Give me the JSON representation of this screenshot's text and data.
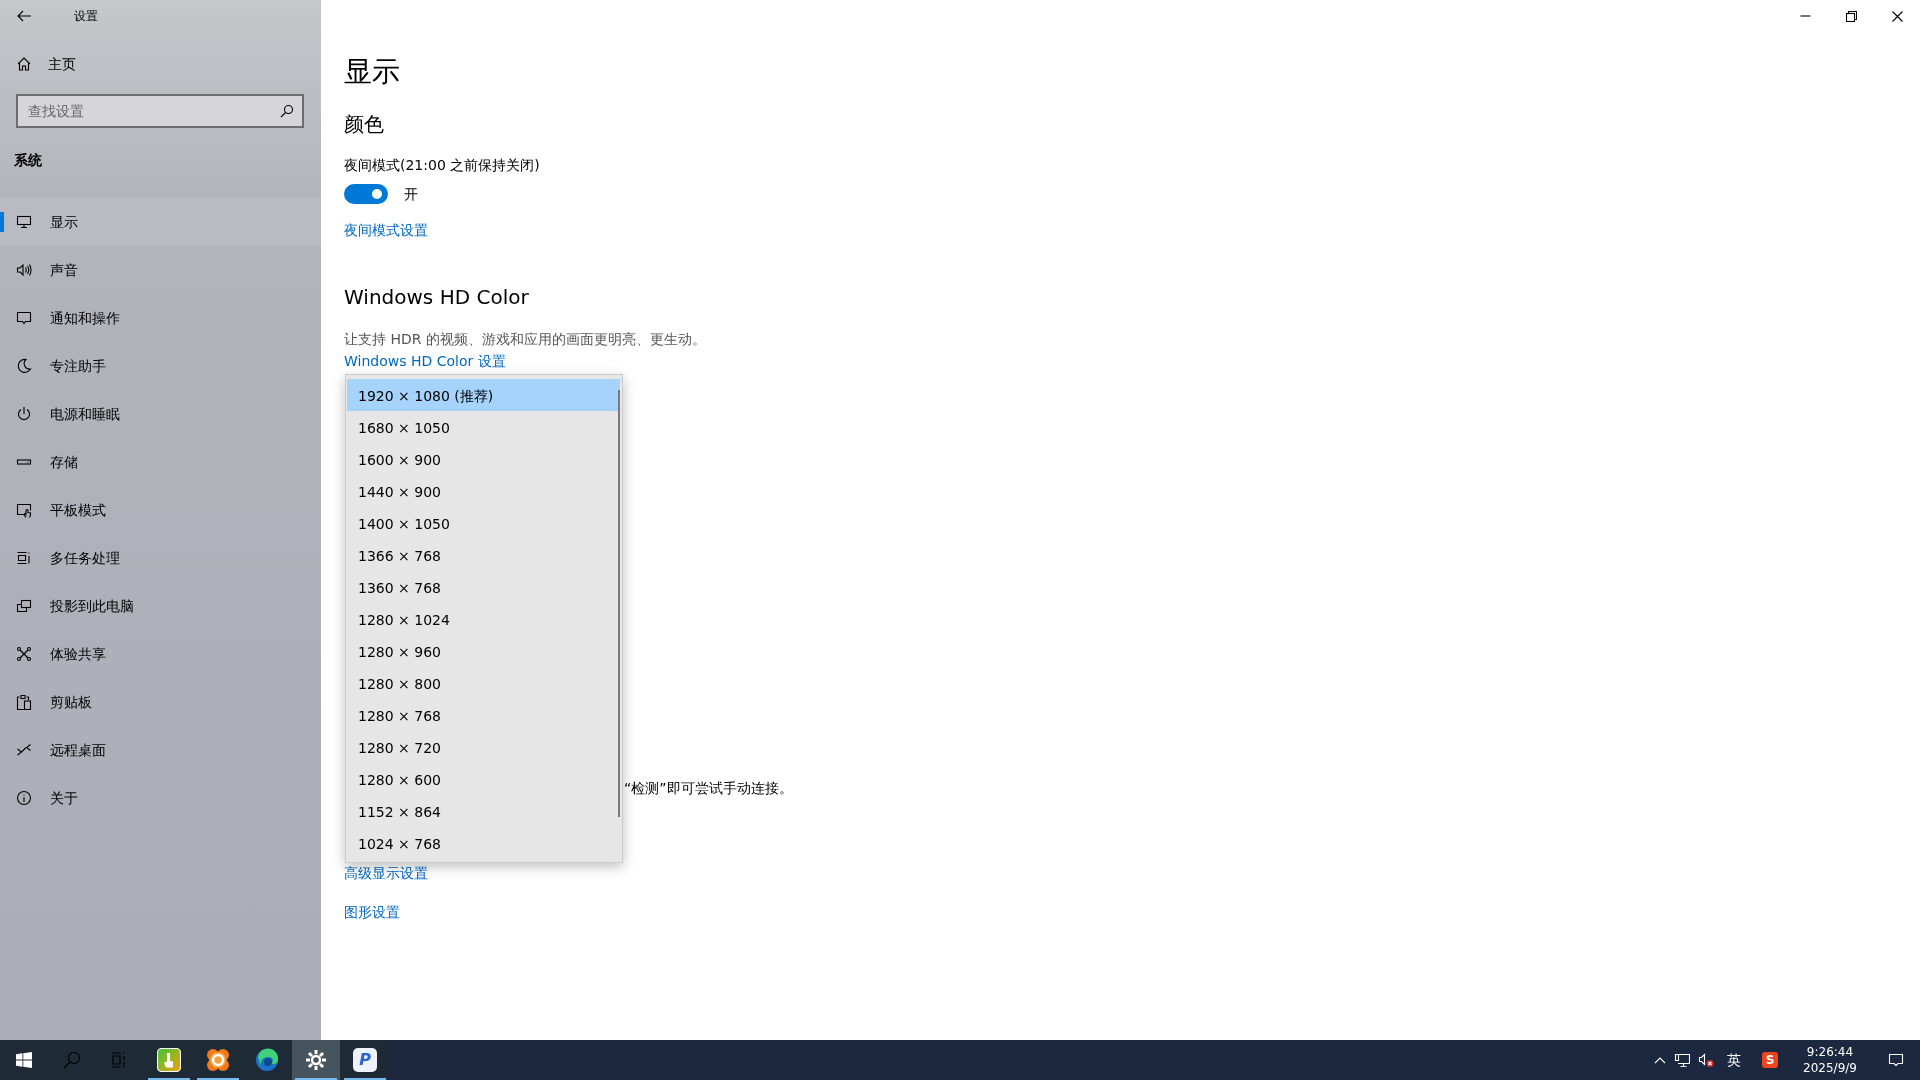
{
  "window": {
    "title": "设置"
  },
  "sidebar": {
    "home": "主页",
    "search": {
      "placeholder": "查找设置"
    },
    "section": "系统",
    "items": [
      {
        "label": "显示",
        "selected": true
      },
      {
        "label": "声音",
        "selected": false
      },
      {
        "label": "通知和操作",
        "selected": false
      },
      {
        "label": "专注助手",
        "selected": false
      },
      {
        "label": "电源和睡眠",
        "selected": false
      },
      {
        "label": "存储",
        "selected": false
      },
      {
        "label": "平板模式",
        "selected": false
      },
      {
        "label": "多任务处理",
        "selected": false
      },
      {
        "label": "投影到此电脑",
        "selected": false
      },
      {
        "label": "体验共享",
        "selected": false
      },
      {
        "label": "剪贴板",
        "selected": false
      },
      {
        "label": "远程桌面",
        "selected": false
      },
      {
        "label": "关于",
        "selected": false
      }
    ]
  },
  "page": {
    "title": "显示",
    "color": {
      "heading": "颜色",
      "night_light_label": "夜间模式(21:00 之前保持关闭)",
      "toggle": {
        "on": true,
        "state_text": "开"
      },
      "link": "夜间模式设置"
    },
    "hd_color": {
      "heading": "Windows HD Color",
      "description": "让支持 HDR 的视频、游戏和应用的画面更明亮、更生动。",
      "link": "Windows HD Color 设置"
    },
    "partial_text": "“检测”即可尝试手动连接。",
    "links": [
      "高级显示设置",
      "图形设置"
    ]
  },
  "resolution_dropdown": {
    "options": [
      {
        "label": "1920 × 1080 (推荐)",
        "selected": true
      },
      {
        "label": "1680 × 1050",
        "selected": false
      },
      {
        "label": "1600 × 900",
        "selected": false
      },
      {
        "label": "1440 × 900",
        "selected": false
      },
      {
        "label": "1400 × 1050",
        "selected": false
      },
      {
        "label": "1366 × 768",
        "selected": false
      },
      {
        "label": "1360 × 768",
        "selected": false
      },
      {
        "label": "1280 × 1024",
        "selected": false
      },
      {
        "label": "1280 × 960",
        "selected": false
      },
      {
        "label": "1280 × 800",
        "selected": false
      },
      {
        "label": "1280 × 768",
        "selected": false
      },
      {
        "label": "1280 × 720",
        "selected": false
      },
      {
        "label": "1280 × 600",
        "selected": false
      },
      {
        "label": "1152 × 864",
        "selected": false
      },
      {
        "label": "1024 × 768",
        "selected": false
      }
    ]
  },
  "taskbar": {
    "apps": [
      {
        "kind": "touch",
        "running": true,
        "selected": false
      },
      {
        "kind": "ring",
        "running": true,
        "selected": false
      },
      {
        "kind": "browser",
        "running": false,
        "selected": false
      },
      {
        "kind": "settings",
        "running": true,
        "selected": true
      },
      {
        "kind": "letter",
        "label": "P",
        "running": true,
        "selected": false
      }
    ],
    "tray": {
      "ime": "英",
      "input_app_label": "S",
      "time": "9:26:44",
      "date": "2025/9/9"
    }
  }
}
